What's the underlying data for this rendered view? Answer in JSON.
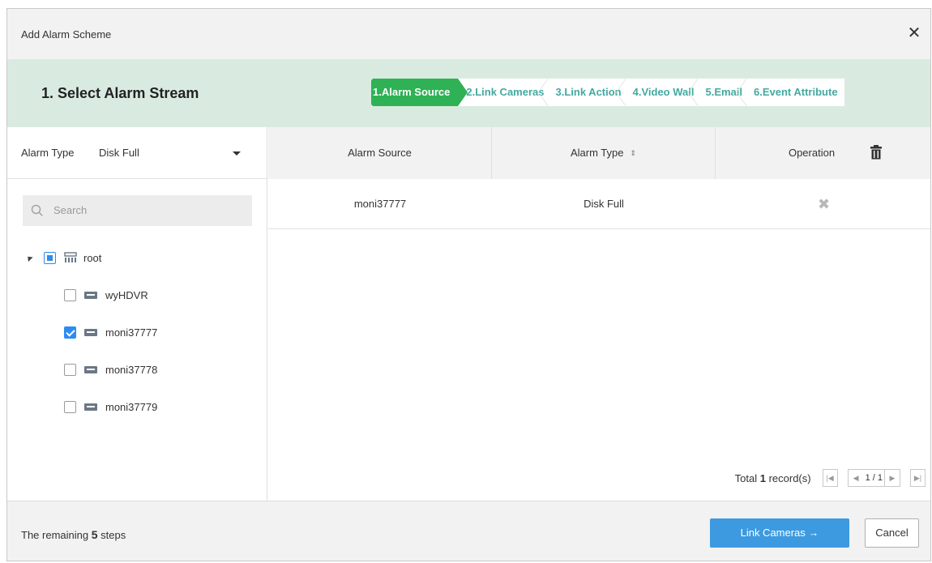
{
  "dialog": {
    "title": "Add Alarm Scheme",
    "close_icon": "close-icon"
  },
  "stepbar": {
    "heading": "1.  Select Alarm Stream",
    "steps": [
      {
        "label": "1.Alarm Source",
        "active": true
      },
      {
        "label": "2.Link Cameras",
        "active": false
      },
      {
        "label": "3.Link Action",
        "active": false
      },
      {
        "label": "4.Video Wall",
        "active": false
      },
      {
        "label": "5.Email",
        "active": false
      },
      {
        "label": "6.Event Attribute",
        "active": false
      }
    ],
    "colors": {
      "active_bg": "#2fb155",
      "inactive_text": "#44a9a1",
      "band_bg": "#d9ebe1"
    }
  },
  "left": {
    "alarm_type_label": "Alarm Type",
    "alarm_type_value": "Disk Full",
    "search_placeholder": "Search",
    "tree": {
      "root": {
        "label": "root",
        "state": "partial"
      },
      "children": [
        {
          "label": "wyHDVR",
          "checked": false
        },
        {
          "label": "moni37777",
          "checked": true
        },
        {
          "label": "moni37778",
          "checked": false
        },
        {
          "label": "moni37779",
          "checked": false
        }
      ]
    }
  },
  "table": {
    "columns": [
      "Alarm Source",
      "Alarm Type",
      "Operation"
    ],
    "rows": [
      {
        "source": "moni37777",
        "type": "Disk Full"
      }
    ],
    "pager": {
      "total_prefix": "Total",
      "total_count": "1",
      "total_suffix": "record(s)",
      "page": "1 / 1"
    }
  },
  "footer": {
    "remaining_prefix": "The remaining",
    "remaining_count": "5",
    "remaining_suffix": "steps",
    "next_label": "Link Cameras  →",
    "cancel_label": "Cancel",
    "accent": "#3d9ae0"
  }
}
